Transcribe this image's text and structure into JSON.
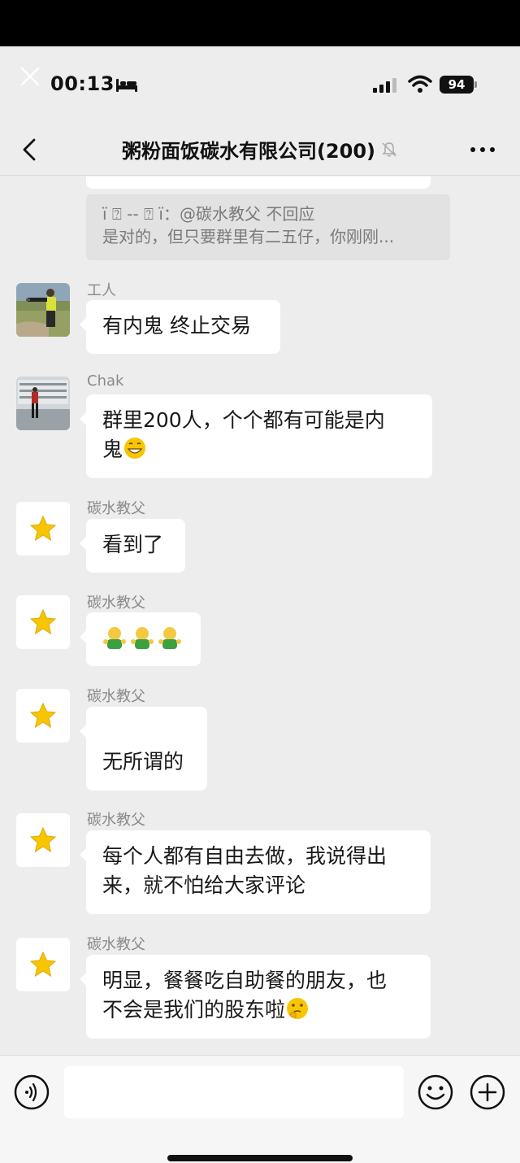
{
  "status_bar": {
    "time": "00:13",
    "battery": "94"
  },
  "header": {
    "title": "粥粉面饭碳水有限公司(200)"
  },
  "quote": {
    "line1": "ï ⍰ -- ⍰ ï：@碳水教父 不回应",
    "line2": "是对的，但只要群里有二五仔，你刚刚..."
  },
  "messages": [
    {
      "sender": "工人",
      "text": "有内鬼 终止交易"
    },
    {
      "sender": "Chak",
      "line1": "群里200人，个个都有可能是内",
      "line2": "鬼"
    },
    {
      "sender": "碳水教父",
      "text": "看到了"
    },
    {
      "sender": "碳水教父",
      "emoji": "🙆🙆🙆"
    },
    {
      "sender": "碳水教父",
      "text": "无所谓的"
    },
    {
      "sender": "碳水教父",
      "line1": "每个人都有自由去做，我说得出",
      "line2": "来，就不怕给大家评论"
    },
    {
      "sender": "碳水教父",
      "line1": "明显，餐餐吃自助餐的朋友，也",
      "line2": "不会是我们的股东啦"
    }
  ],
  "icons": {
    "close": "close-icon",
    "sleep": "bed-icon",
    "signal": "signal-icon",
    "wifi": "wifi-icon",
    "back": "chevron-left-icon",
    "mute": "bell-off-icon",
    "more": "more-dots-icon",
    "voice": "voice-icon",
    "emoji": "emoji-icon",
    "plus": "plus-icon",
    "star_avatar": "star-icon"
  },
  "colors": {
    "background": "#ededed",
    "bubble": "#ffffff",
    "quote_bg": "#e2e2e2",
    "star": "#f7c600"
  }
}
